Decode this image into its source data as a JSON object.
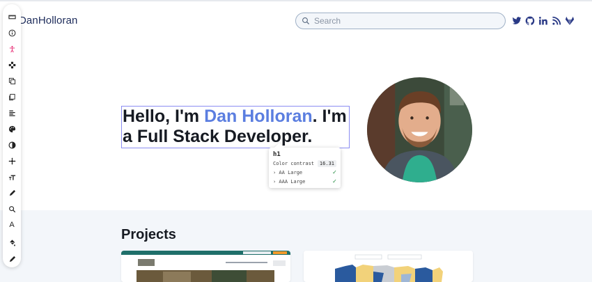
{
  "header": {
    "brand": "DanHolloran",
    "search_placeholder": "Search",
    "social_icons": [
      "twitter-icon",
      "github-icon",
      "linkedin-icon",
      "rss-icon",
      "gitlab-icon"
    ],
    "accent_color": "#2a3a86"
  },
  "toolbar": {
    "tools": [
      "ruler-icon",
      "info-icon",
      "accessibility-icon",
      "move-icon",
      "duplicate-icon",
      "copy-icon",
      "align-icon",
      "palette-icon",
      "contrast-icon",
      "position-icon",
      "text-size-icon",
      "pencil-icon",
      "search-icon",
      "text-icon",
      "fill-icon",
      "edit-icon"
    ],
    "text_tool_label": "A"
  },
  "hero": {
    "line1_prefix": "Hello, I'm ",
    "name": "Dan Holloran",
    "line1_suffix": ". I'm",
    "line2": "a Full Stack Developer.",
    "name_color": "#5b7ee0"
  },
  "inspector": {
    "tag": "h1",
    "contrast_label": "Color contrast",
    "contrast_value": "16.31",
    "aa_label": "› AA Large",
    "aaa_label": "› AAA Large",
    "check": "✓"
  },
  "projects": {
    "title": "Projects"
  }
}
